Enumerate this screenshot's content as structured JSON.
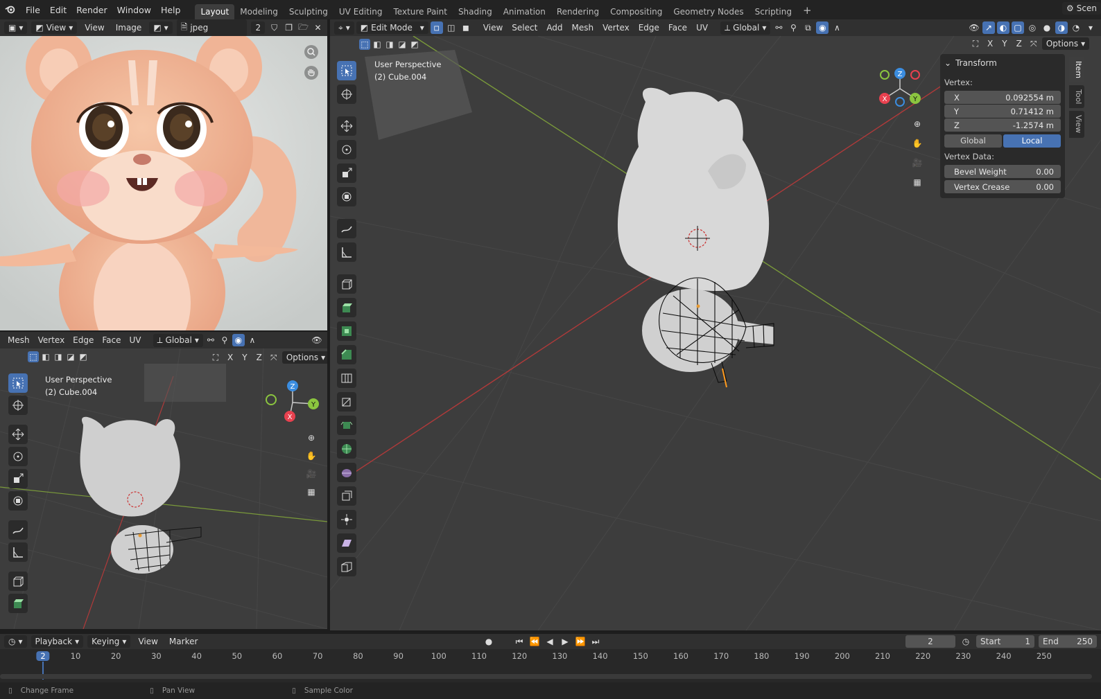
{
  "top_menu": [
    "File",
    "Edit",
    "Render",
    "Window",
    "Help"
  ],
  "workspace_tabs": [
    {
      "label": "Layout",
      "active": true
    },
    {
      "label": "Modeling",
      "active": false
    },
    {
      "label": "Sculpting",
      "active": false
    },
    {
      "label": "UV Editing",
      "active": false
    },
    {
      "label": "Texture Paint",
      "active": false
    },
    {
      "label": "Shading",
      "active": false
    },
    {
      "label": "Animation",
      "active": false
    },
    {
      "label": "Rendering",
      "active": false
    },
    {
      "label": "Compositing",
      "active": false
    },
    {
      "label": "Geometry Nodes",
      "active": false
    },
    {
      "label": "Scripting",
      "active": false
    }
  ],
  "scene_label": "Scen",
  "image_editor": {
    "view": "View",
    "menu_view": "View",
    "menu_image": "Image",
    "image_name": "jpeg",
    "user_count": "2"
  },
  "left_viewport": {
    "menus": [
      "Mesh",
      "Vertex",
      "Edge",
      "Face",
      "UV"
    ],
    "orientation": "Global",
    "options": "Options",
    "axes": [
      "X",
      "Y",
      "Z"
    ],
    "perspective": "User Perspective",
    "object": "(2) Cube.004"
  },
  "main_viewport": {
    "mode": "Edit Mode",
    "menus": [
      "View",
      "Select",
      "Add",
      "Mesh",
      "Vertex",
      "Edge",
      "Face",
      "UV"
    ],
    "orientation": "Global",
    "options": "Options",
    "axes": [
      "X",
      "Y",
      "Z"
    ],
    "perspective": "User Perspective",
    "object": "(2) Cube.004"
  },
  "npanel": {
    "section": "Transform",
    "vertex_label": "Vertex:",
    "x_label": "X",
    "x_value": "0.092554 m",
    "y_label": "Y",
    "y_value": "0.71412 m",
    "z_label": "Z",
    "z_value": "-1.2574 m",
    "global_btn": "Global",
    "local_btn": "Local",
    "vertex_data_label": "Vertex Data:",
    "bevel_label": "Bevel Weight",
    "bevel_value": "0.00",
    "crease_label": "Vertex Crease",
    "crease_value": "0.00",
    "tabs": [
      "Item",
      "Tool",
      "View"
    ]
  },
  "timeline": {
    "menus": [
      "Playback",
      "Keying",
      "View",
      "Marker"
    ],
    "current_frame": "2",
    "start_label": "Start",
    "start_value": "1",
    "end_label": "End",
    "end_value": "250",
    "ruler_frames": [
      "2",
      "10",
      "20",
      "30",
      "40",
      "50",
      "60",
      "70",
      "80",
      "90",
      "100",
      "110",
      "120",
      "130",
      "140",
      "150",
      "160",
      "170",
      "180",
      "190",
      "200",
      "210",
      "220",
      "230",
      "240",
      "250"
    ]
  },
  "statusbar": {
    "item1": "Change Frame",
    "item2": "Pan View",
    "item3": "Sample Color"
  },
  "colors": {
    "accent": "#4772b3",
    "axis_x": "#e8414f",
    "axis_y": "#8bc53f",
    "axis_z": "#3b8de0"
  }
}
